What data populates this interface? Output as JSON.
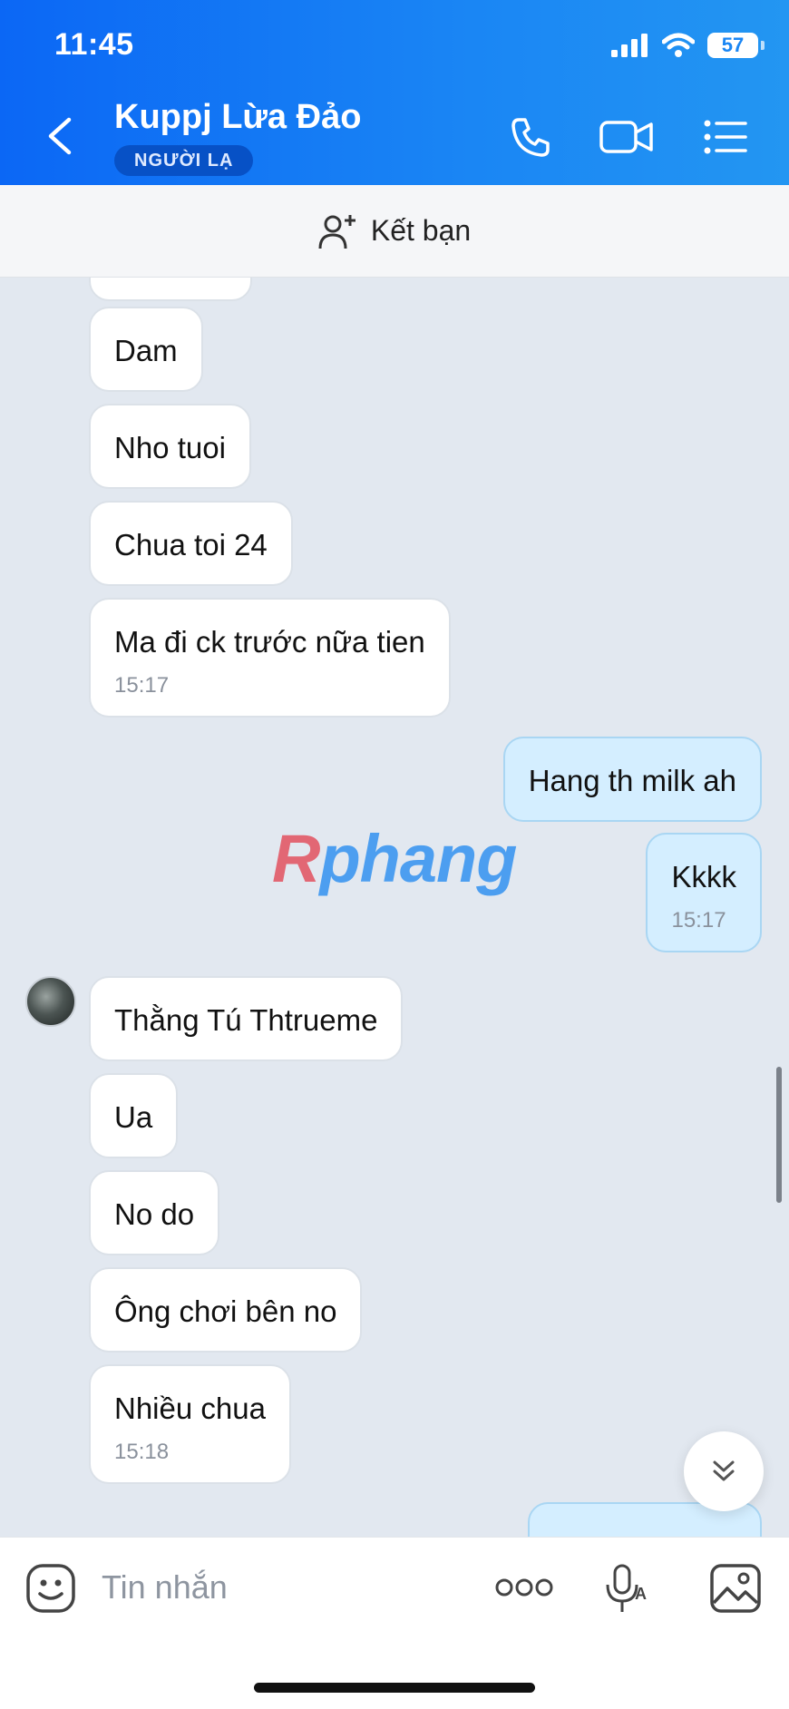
{
  "status_bar": {
    "time": "11:45",
    "battery": "57"
  },
  "header": {
    "contact_name": "Kuppj Lừa Đảo",
    "badge": "NGƯỜI LẠ",
    "icons": [
      "back-icon",
      "phone-icon",
      "video-call-icon",
      "menu-list-icon"
    ]
  },
  "friend_bar": {
    "label": "Kết bạn",
    "icon": "add-user-icon"
  },
  "messages": [
    {
      "text": "Dam",
      "sender": "other"
    },
    {
      "text": "Nho tuoi",
      "sender": "other"
    },
    {
      "text": "Chua toi 24",
      "sender": "other"
    },
    {
      "text": "Ma đi ck trước nữa tien",
      "time": "15:17",
      "sender": "other"
    },
    {
      "text": "Hang th milk ah",
      "sender": "me"
    },
    {
      "text": "Kkkk",
      "time": "15:17",
      "sender": "me"
    },
    {
      "text": "Thằng Tú Thtrueme",
      "sender": "other"
    },
    {
      "text": "Ua",
      "sender": "other"
    },
    {
      "text": "No do",
      "sender": "other"
    },
    {
      "text": "Ông chơi bên no",
      "sender": "other"
    },
    {
      "text": "Nhiều chua",
      "time": "15:18",
      "sender": "other"
    }
  ],
  "watermark": {
    "first": "R",
    "rest": "phang"
  },
  "input_bar": {
    "placeholder": "Tin nhắn",
    "icons": [
      "sticker-icon",
      "more-icon",
      "voice-to-text-icon",
      "image-icon"
    ]
  },
  "colors": {
    "header": "#1a86f4",
    "my_bubble": "#d4eeff",
    "other_bubble": "#ffffff",
    "background": "#e2e8f0"
  }
}
